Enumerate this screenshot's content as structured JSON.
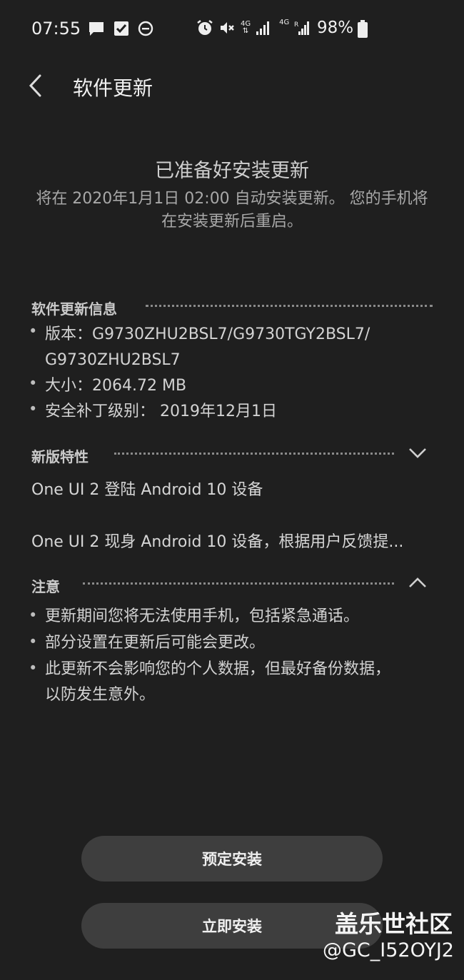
{
  "status_bar": {
    "time": "07:55",
    "battery": "98%",
    "icons": [
      "chat-icon",
      "check-icon",
      "dnd-icon",
      "alarm-icon",
      "mute-icon",
      "4g-icon",
      "signal-icon",
      "4g-icon",
      "signal-r-icon",
      "battery-icon"
    ],
    "net1": "4G",
    "net2": "4G"
  },
  "header": {
    "title": "软件更新"
  },
  "headline": {
    "title": "已准备好安装更新",
    "subtitle": "将在 2020年1月1日 02:00 自动安装更新。 您的手机将在安装更新后重启。"
  },
  "info": {
    "title": "软件更新信息",
    "version_line1": "版本：G9730ZHU2BSL7/G9730TGY2BSL7/",
    "version_line2": "G9730ZHU2BSL7",
    "size": "大小：2064.72 MB",
    "patch": "安全补丁级别： 2019年12月1日"
  },
  "features": {
    "title": "新版特性",
    "line1": "One UI 2 登陆 Android 10 设备",
    "line2": "One UI 2 现身 Android 10 设备，根据用户反馈提..."
  },
  "notice": {
    "title": "注意",
    "item1": "更新期间您将无法使用手机，包括紧急通话。",
    "item2": "部分设置在更新后可能会更改。",
    "item3_line1": "此更新不会影响您的个人数据，但最好备份数据，",
    "item3_line2": "以防发生意外。"
  },
  "buttons": {
    "schedule": "预定安装",
    "install_now": "立即安装"
  },
  "watermark": {
    "line1": "盖乐世社区",
    "line2": "@GC_I52OYJ2"
  },
  "bullet_char": "•"
}
